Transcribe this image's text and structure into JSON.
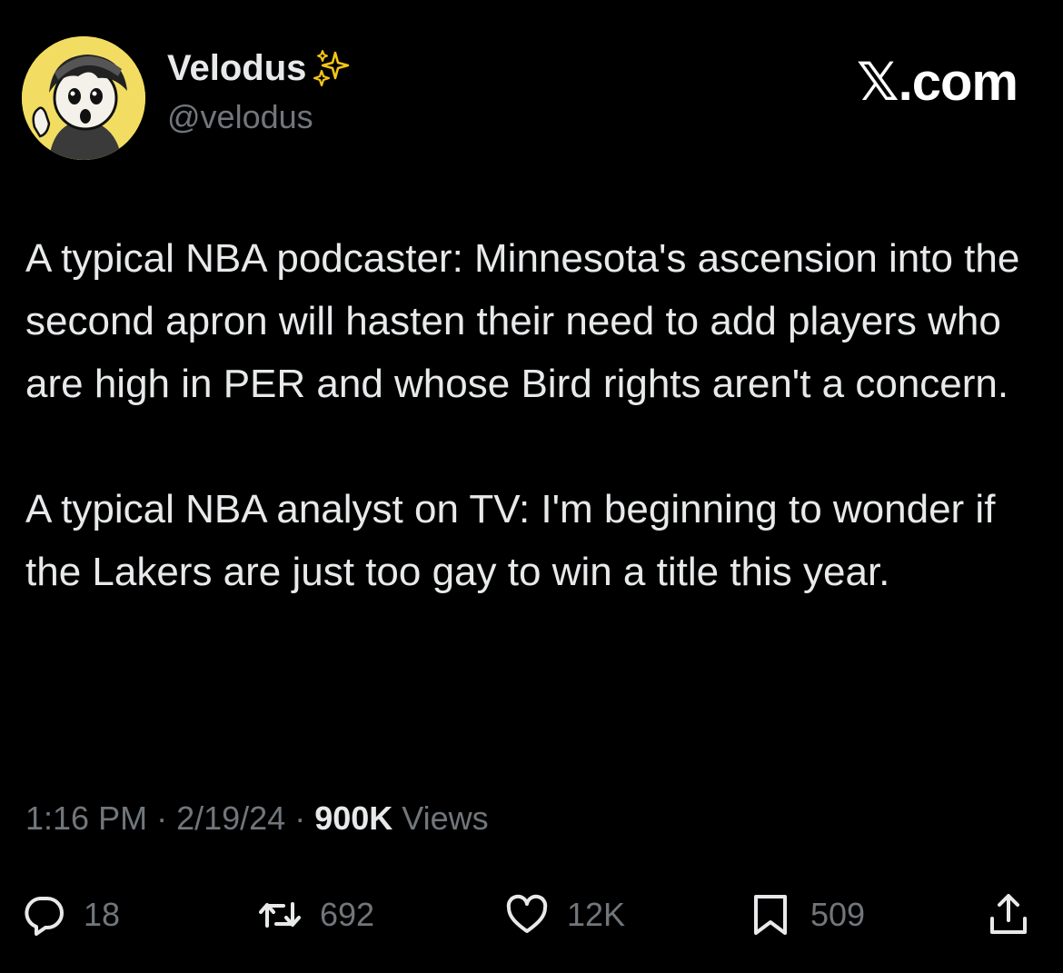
{
  "author": {
    "display_name": "Velodus",
    "badge_icon": "sparkles-icon",
    "handle": "@velodus"
  },
  "brand": {
    "label": "𝕏.com"
  },
  "tweet": {
    "paragraphs": [
      "A typical NBA podcaster: Minnesota's ascension into the second apron will hasten their need to add players who are high in PER and whose Bird rights aren't a concern.",
      "A typical NBA analyst on TV: I'm beginning to wonder if the Lakers are just too gay to win a title this year."
    ]
  },
  "meta": {
    "time": "1:16 PM",
    "separator": " · ",
    "date": "2/19/24",
    "views_count": "900K",
    "views_label": " Views"
  },
  "actions": {
    "reply": {
      "icon": "reply-icon",
      "count": "18"
    },
    "repost": {
      "icon": "repost-icon",
      "count": "692"
    },
    "like": {
      "icon": "heart-icon",
      "count": "12K"
    },
    "bookmark": {
      "icon": "bookmark-icon",
      "count": "509"
    },
    "share": {
      "icon": "share-icon"
    }
  },
  "colors": {
    "background": "#000000",
    "primary_text": "#e7e9ea",
    "secondary_text": "#71767b",
    "sparkle": "#f5c518"
  }
}
